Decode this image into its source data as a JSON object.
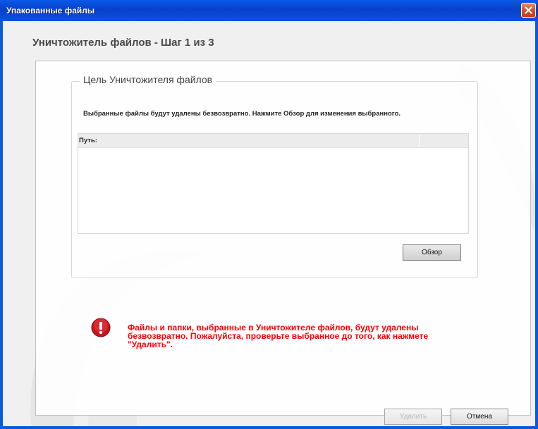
{
  "window": {
    "title": "Упакованные файлы",
    "close_icon": "close-icon"
  },
  "wizard": {
    "step_title": "Уничтожитель файлов - Шаг 1 из 3"
  },
  "target_group": {
    "legend": "Цель Уничтожителя файлов",
    "description": "Выбранные файлы будут удалены безвозвратно. Нажмите Обзор для изменения выбранного.",
    "list": {
      "columns": [
        "Путь:",
        ""
      ],
      "rows": []
    },
    "browse_label": "Обзор"
  },
  "warning": {
    "icon": "exclamation-icon",
    "text": "Файлы и папки, выбранные в Уничтожителе файлов, будут удалены безвозвратно. Пожалуйста, проверьте выбранное до того, как нажмете \"Удалить\".",
    "color": "#ff0000"
  },
  "footer": {
    "delete_label": "Удалить",
    "delete_enabled": false,
    "cancel_label": "Отмена"
  },
  "colors": {
    "titlebar": "#0a4ad8",
    "close_button": "#d8502f",
    "warning_icon": "#c8141e"
  }
}
